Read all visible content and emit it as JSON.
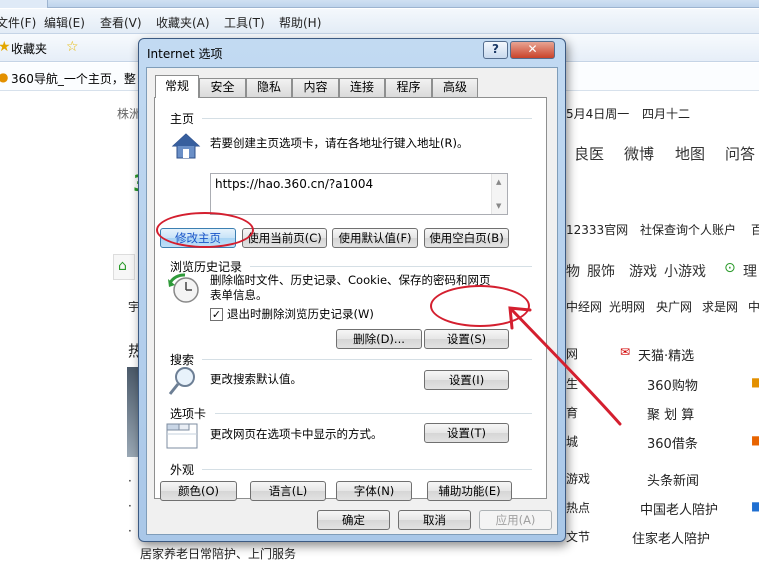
{
  "browser": {
    "menu": [
      "文件(F)",
      "编辑(E)",
      "查看(V)",
      "收藏夹(A)",
      "工具(T)",
      "帮助(H)"
    ],
    "favorites_label": "收藏夹",
    "site_title": "360导航_一个主页，整",
    "date": "5月4日周一",
    "lunar": "四月十二",
    "weather_city": "株洲",
    "nav": [
      "良医",
      "微博",
      "地图",
      "问答"
    ],
    "links_row1": "12333官网",
    "links_row1b": "社保查询个人账户",
    "cat_row": [
      "物",
      "服饰",
      "游戏",
      "小游戏"
    ],
    "news_row": [
      "中经网",
      "光明网",
      "央广网",
      "求是网",
      "中国网"
    ],
    "left_home": "宇",
    "left_hot": "热",
    "list_items": [
      "网",
      "生",
      "育",
      "城",
      "游戏",
      "热点",
      "文节"
    ],
    "right_items": [
      "天猫·精选",
      "360购物",
      "聚 划 算",
      "360借条",
      "头条新闻",
      "中国老人陪护",
      "住家老人陪护"
    ],
    "bottom_text": "居家养老日常陪护、上门服务"
  },
  "dialog": {
    "title": "Internet 选项",
    "help_label": "?",
    "tabs": [
      "常规",
      "安全",
      "隐私",
      "内容",
      "连接",
      "程序",
      "高级"
    ],
    "homepage": {
      "section": "主页",
      "desc": "若要创建主页选项卡，请在各地址行键入地址(R)。",
      "address": "https://hao.360.cn/?a1004",
      "buttons": [
        "修改主页",
        "使用当前页(C)",
        "使用默认值(F)",
        "使用空白页(B)"
      ]
    },
    "history": {
      "section": "浏览历史记录",
      "desc_line1": "删除临时文件、历史记录、Cookie、保存的密码和网页",
      "desc_line2": "表单信息。",
      "checkbox_label": "退出时删除浏览历史记录(W)",
      "checkbox_checked": true,
      "delete_button": "删除(D)...",
      "settings_button": "设置(S)"
    },
    "search": {
      "section": "搜索",
      "desc": "更改搜索默认值。",
      "settings_button": "设置(I)"
    },
    "tabs_section": {
      "section": "选项卡",
      "desc": "更改网页在选项卡中显示的方式。",
      "settings_button": "设置(T)"
    },
    "appearance": {
      "section": "外观",
      "buttons": [
        "颜色(O)",
        "语言(L)",
        "字体(N)",
        "辅助功能(E)"
      ]
    },
    "footer": {
      "ok": "确定",
      "cancel": "取消",
      "apply": "应用(A)"
    }
  },
  "annotation_color": "#d41f2f"
}
